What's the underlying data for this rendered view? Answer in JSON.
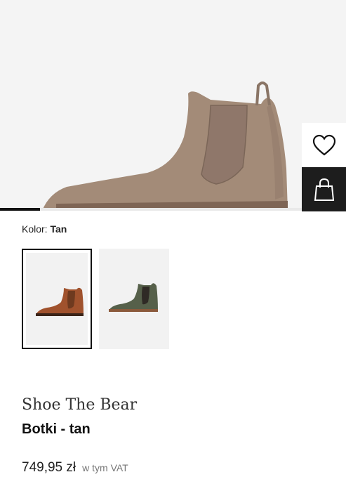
{
  "product": {
    "image_alt_icon": "chelsea-boot",
    "gallery_progress": 0.115,
    "color_label": "Kolor:",
    "color_value": "Tan",
    "variants": [
      {
        "icon": "chelsea-boot",
        "color": "#a0522d",
        "selected": true
      },
      {
        "icon": "chelsea-boot",
        "color": "#56604a",
        "selected": false
      }
    ],
    "brand": "Shoe The Bear",
    "name": "Botki - tan",
    "price": "749,95 zł",
    "vat_note": "w tym VAT"
  },
  "actions": {
    "wishlist_icon": "heart-icon",
    "bag_icon": "shopping-bag-icon"
  },
  "colors": {
    "hero_boot": "#a38b78",
    "accent": "#1d1d1d"
  }
}
